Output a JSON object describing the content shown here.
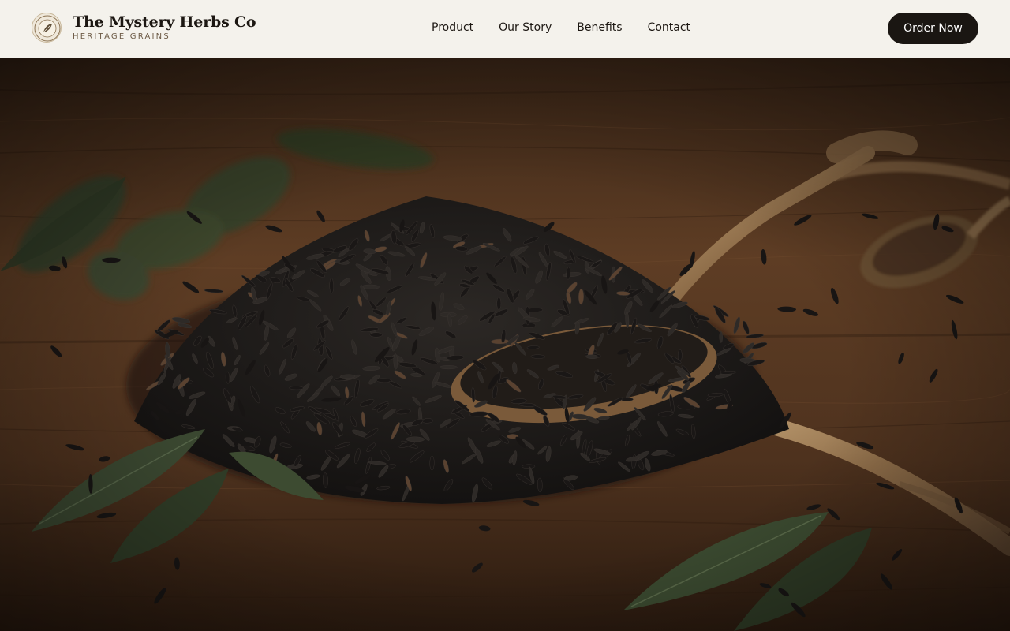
{
  "brand": {
    "name": "The Mystery Herbs Co",
    "tagline": "HERITAGE GRAINS",
    "logo_icon": "herb-seal-icon"
  },
  "nav": {
    "links": [
      "Product",
      "Our Story",
      "Benefits",
      "Contact"
    ]
  },
  "cta": {
    "label": "Order Now"
  },
  "hero": {
    "image": "black-rice-pile-with-spoon-on-wooden-table",
    "colors": {
      "wood": "#5a3a22",
      "rice": "#1e1b19",
      "leaf": "#3d4a30",
      "spoon": "#9c7a55"
    }
  }
}
